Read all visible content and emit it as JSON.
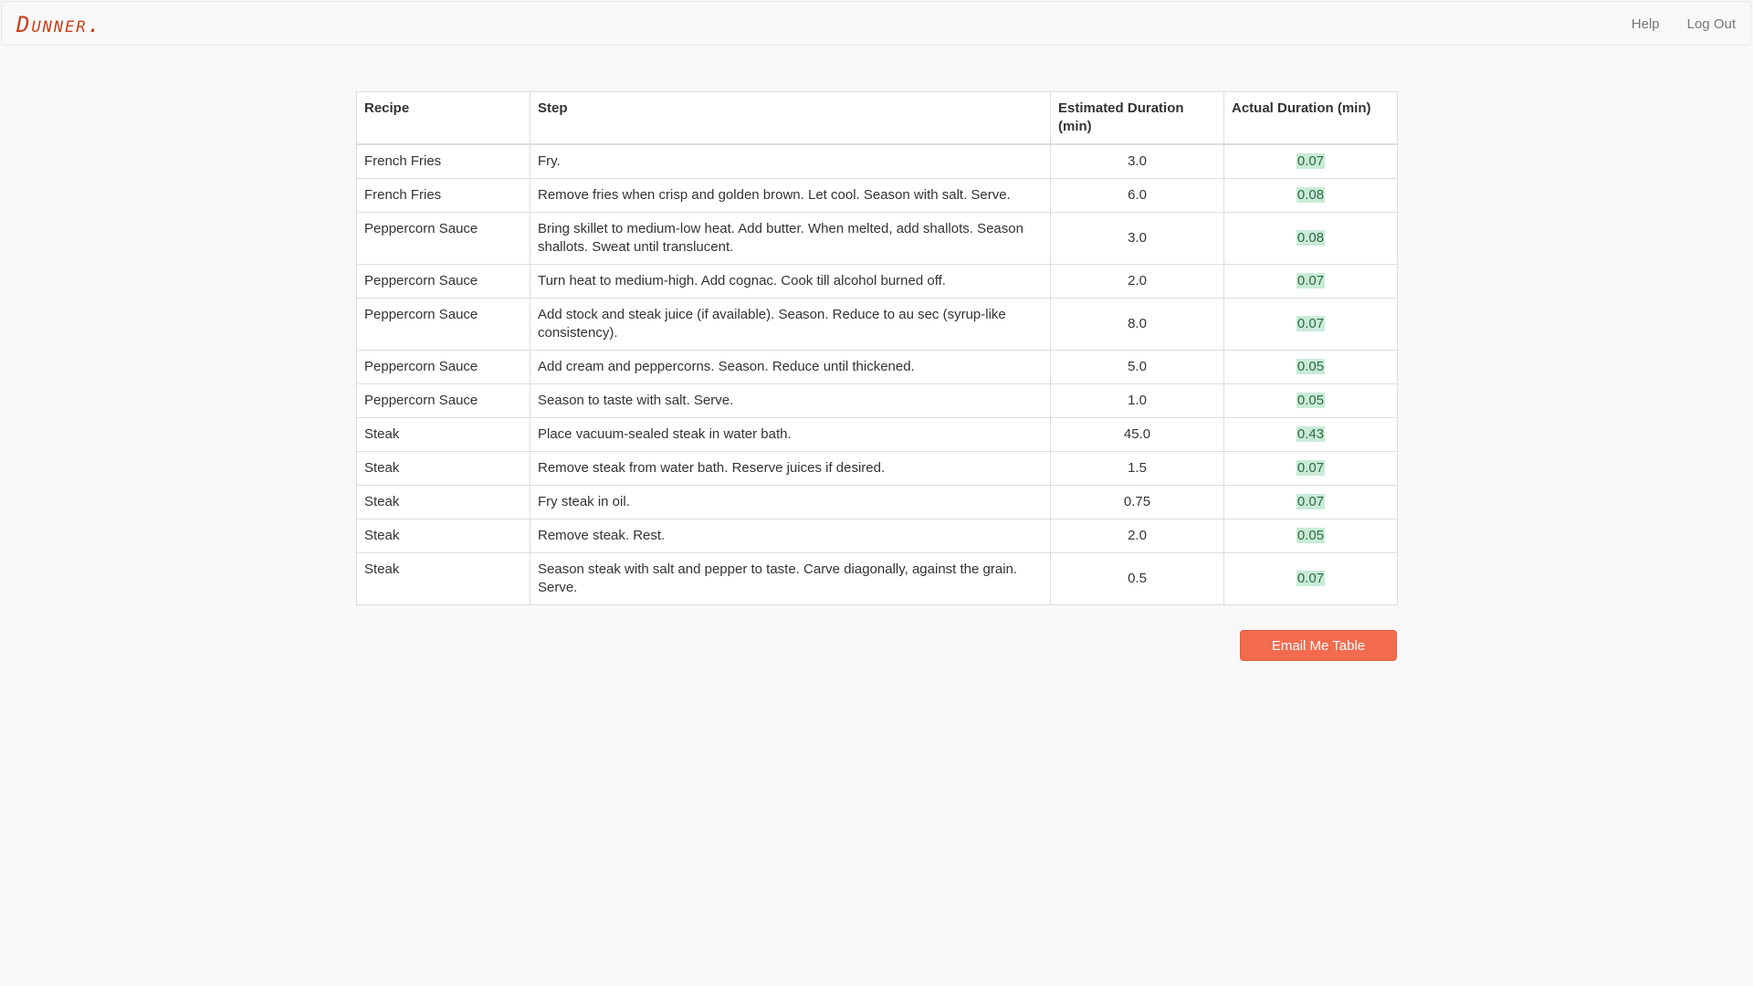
{
  "nav": {
    "brand": "Dunner.",
    "links": [
      "Help",
      "Log Out"
    ]
  },
  "table": {
    "headers": [
      "Recipe",
      "Step",
      "Estimated Duration (min)",
      "Actual Duration (min)"
    ],
    "rows": [
      {
        "recipe": "French Fries",
        "step": "Fry.",
        "estimated": "3.0",
        "actual": "0.07"
      },
      {
        "recipe": "French Fries",
        "step": "Remove fries when crisp and golden brown. Let cool. Season with salt. Serve.",
        "estimated": "6.0",
        "actual": "0.08"
      },
      {
        "recipe": "Peppercorn Sauce",
        "step": "Bring skillet to medium-low heat. Add butter. When melted, add shallots. Season shallots. Sweat until translucent.",
        "estimated": "3.0",
        "actual": "0.08"
      },
      {
        "recipe": "Peppercorn Sauce",
        "step": "Turn heat to medium-high. Add cognac. Cook till alcohol burned off.",
        "estimated": "2.0",
        "actual": "0.07"
      },
      {
        "recipe": "Peppercorn Sauce",
        "step": "Add stock and steak juice (if available). Season. Reduce to au sec (syrup-like consistency).",
        "estimated": "8.0",
        "actual": "0.07"
      },
      {
        "recipe": "Peppercorn Sauce",
        "step": "Add cream and peppercorns. Season. Reduce until thickened.",
        "estimated": "5.0",
        "actual": "0.05"
      },
      {
        "recipe": "Peppercorn Sauce",
        "step": "Season to taste with salt. Serve.",
        "estimated": "1.0",
        "actual": "0.05"
      },
      {
        "recipe": "Steak",
        "step": "Place vacuum-sealed steak in water bath.",
        "estimated": "45.0",
        "actual": "0.43"
      },
      {
        "recipe": "Steak",
        "step": "Remove steak from water bath. Reserve juices if desired.",
        "estimated": "1.5",
        "actual": "0.07"
      },
      {
        "recipe": "Steak",
        "step": "Fry steak in oil.",
        "estimated": "0.75",
        "actual": "0.07"
      },
      {
        "recipe": "Steak",
        "step": "Remove steak. Rest.",
        "estimated": "2.0",
        "actual": "0.05"
      },
      {
        "recipe": "Steak",
        "step": "Season steak with salt and pepper to taste. Carve diagonally, against the grain. Serve.",
        "estimated": "0.5",
        "actual": "0.07"
      }
    ]
  },
  "email_button": "Email Me Table",
  "colors": {
    "brand": "#c8401a",
    "button": "#f26b4e",
    "actual_highlight": "#c9ebd8"
  }
}
